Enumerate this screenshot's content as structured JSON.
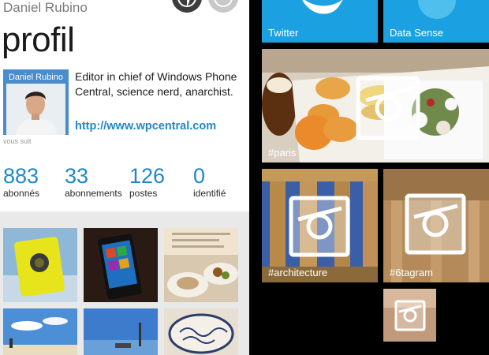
{
  "profile": {
    "user_name": "Daniel Rubino",
    "page_title": "profil",
    "avatar_name": "Daniel Rubino",
    "follows_you": "vous suit",
    "bio": "Editor in chief of Windows Phone Central, science nerd, anarchist.",
    "website": "http://www.wpcentral.com",
    "stats": [
      {
        "value": "883",
        "label": "abonnés"
      },
      {
        "value": "33",
        "label": "abonnements"
      },
      {
        "value": "126",
        "label": "postes"
      },
      {
        "value": "0",
        "label": "identifié"
      }
    ]
  },
  "tiles": {
    "twitter": "Twitter",
    "data_sense": "Data Sense",
    "paris": "#paris",
    "architecture": "#architecture",
    "6tagram": "#6tagram"
  },
  "colors": {
    "accent_blue": "#1e88c7",
    "tile_blue": "#1ba1e2"
  }
}
